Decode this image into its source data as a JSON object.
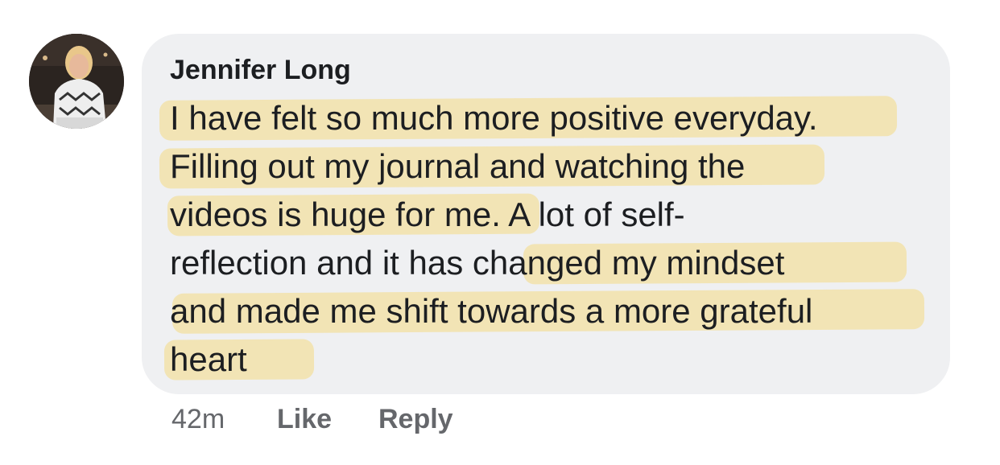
{
  "comment": {
    "author": "Jennifer Long",
    "lines": [
      "I have felt so much more positive everyday.",
      "Filling out my journal and watching the",
      "videos is huge for me. A lot of self-",
      "reflection and it has changed my mindset",
      "and made me shift towards a more grateful",
      "heart"
    ],
    "highlight_color": "#f6d562",
    "bubble_color": "#eff0f2"
  },
  "meta": {
    "time": "42m",
    "like_label": "Like",
    "reply_label": "Reply"
  }
}
